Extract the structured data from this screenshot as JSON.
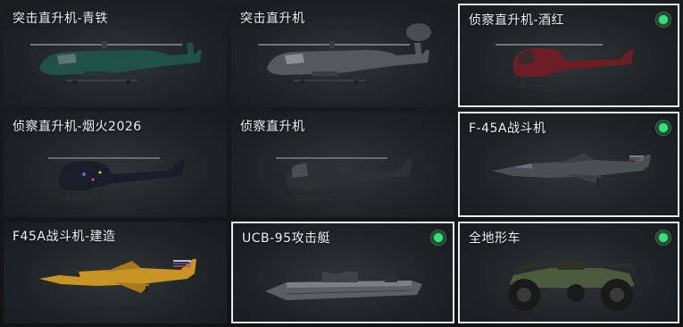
{
  "accent_owned": "#36e07a",
  "cards": [
    {
      "title": "突击直升机-青铁",
      "icon": "attack-helicopter-icon",
      "owned": false,
      "selected": false
    },
    {
      "title": "突击直升机",
      "icon": "attack-helicopter-icon",
      "owned": false,
      "selected": false
    },
    {
      "title": "侦察直升机-酒红",
      "icon": "scout-helicopter-icon",
      "owned": true,
      "selected": true
    },
    {
      "title": "侦察直升机-烟火2026",
      "icon": "scout-helicopter-icon",
      "owned": false,
      "selected": false
    },
    {
      "title": "侦察直升机",
      "icon": "scout-helicopter-icon",
      "owned": false,
      "selected": false
    },
    {
      "title": "F-45A战斗机",
      "icon": "fighter-jet-icon",
      "owned": true,
      "selected": true
    },
    {
      "title": "F45A战斗机-建造",
      "icon": "fighter-jet-icon",
      "owned": false,
      "selected": false
    },
    {
      "title": "UCB-95攻击艇",
      "icon": "attack-boat-icon",
      "owned": true,
      "selected": true
    },
    {
      "title": "全地形车",
      "icon": "atv-icon",
      "owned": true,
      "selected": true
    }
  ]
}
